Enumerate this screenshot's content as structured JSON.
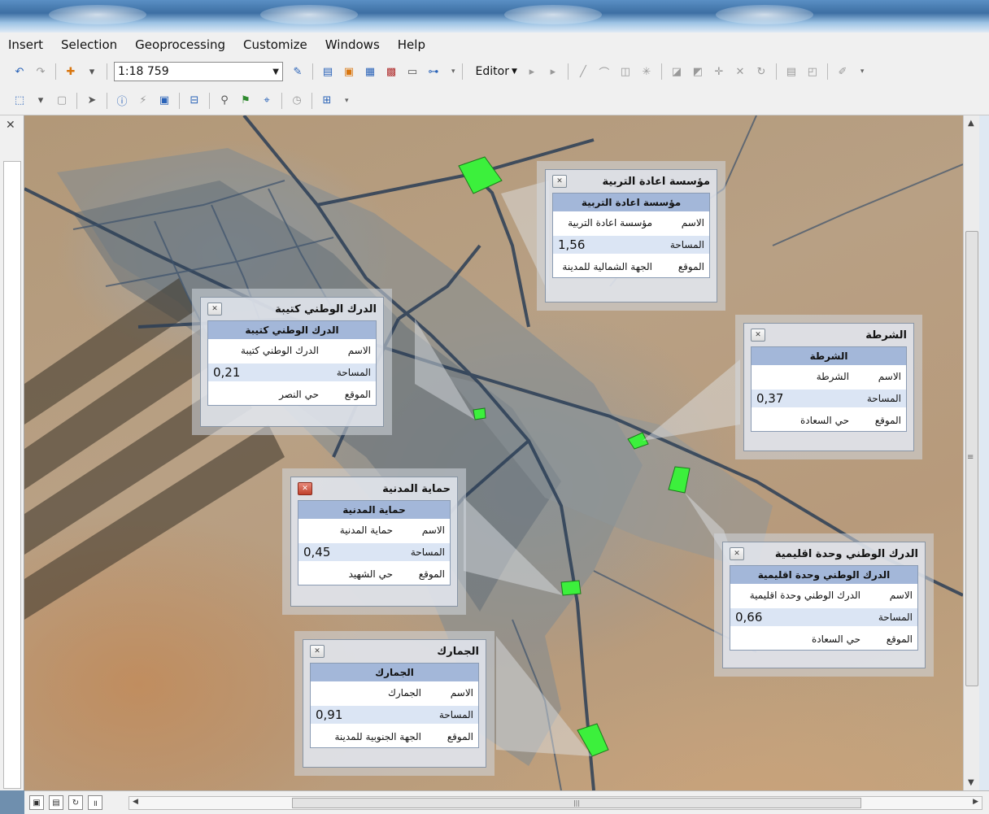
{
  "menu": [
    "Insert",
    "Selection",
    "Geoprocessing",
    "Customize",
    "Windows",
    "Help"
  ],
  "toolbar": {
    "scale": "1:18 759",
    "editor_label": "Editor"
  },
  "popups": [
    {
      "title": "مؤسسة اعادة التربية",
      "header": "مؤسسة اعادة التربية",
      "name": "مؤسسة اعادة التربية",
      "area": "1,56",
      "location": "الجهة الشمالية للمدينة"
    },
    {
      "title": "الدرك الوطني كتيبة",
      "header": "الدرك الوطني كتيبة",
      "name": "الدرك الوطني كتيبة",
      "area": "0,21",
      "location": "حي النصر"
    },
    {
      "title": "الشرطة",
      "header": "الشرطة",
      "name": "الشرطة",
      "area": "0,37",
      "location": "حي السعادة"
    },
    {
      "title": "حماية المدنية",
      "header": "حماية المدنية",
      "name": "حماية المدنية",
      "area": "0,45",
      "location": "حي الشهيد"
    },
    {
      "title": "الدرك الوطني وحدة اقليمية",
      "header": "الدرك الوطني وحدة اقليمية",
      "name": "الدرك الوطني وحدة اقليمية",
      "area": "0,66",
      "location": "حي السعادة"
    },
    {
      "title": "الجمارك",
      "header": "الجمارك",
      "name": "الجمارك",
      "area": "0,91",
      "location": "الجهة الجنوبية للمدينة"
    }
  ],
  "field_labels": {
    "name": "الاسم",
    "area": "المساحة",
    "location": "الموقع"
  },
  "colors": {
    "highlight_polygon": "#3cf03c",
    "popup_header": "#a3b7d9",
    "road": "#2b3e56"
  },
  "icons": [
    "undo-icon",
    "redo-icon",
    "add-data-icon",
    "editor-toolbar-icon",
    "select-features-icon",
    "identify-icon",
    "html-popup-icon",
    "measure-icon",
    "find-icon",
    "go-to-xy-icon"
  ]
}
